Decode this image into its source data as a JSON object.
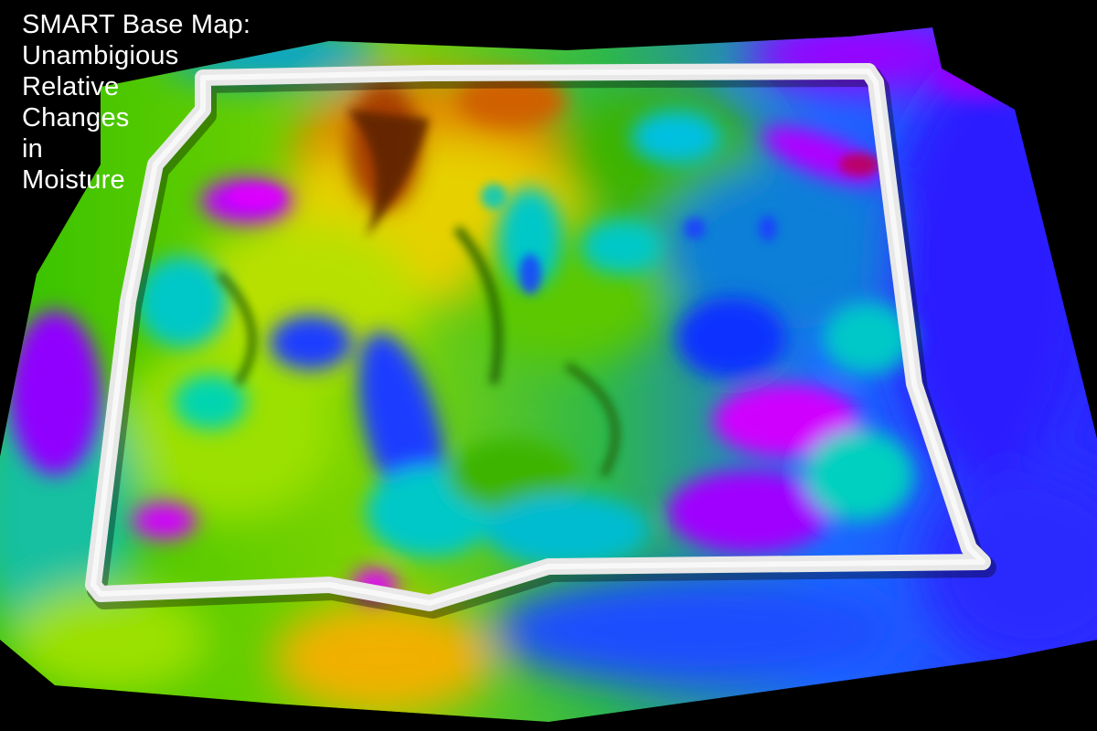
{
  "caption": {
    "lines": [
      "SMART Base Map:",
      "Unambigious",
      "Relative",
      "Changes",
      "in",
      "Moisture"
    ]
  },
  "colors": {
    "background": "#000000",
    "caption_text": "#ffffff",
    "survey_frame": "#e8e8e8",
    "ramp": [
      "#ff9800",
      "#f2d000",
      "#9be000",
      "#35c200",
      "#00c8c8",
      "#1a3cff",
      "#7a00ff",
      "#ff00ff"
    ]
  },
  "map": {
    "type": "3d-relief-moisture-map",
    "projection": "oblique-perspective",
    "survey_frame": "white rectangular boundary"
  }
}
